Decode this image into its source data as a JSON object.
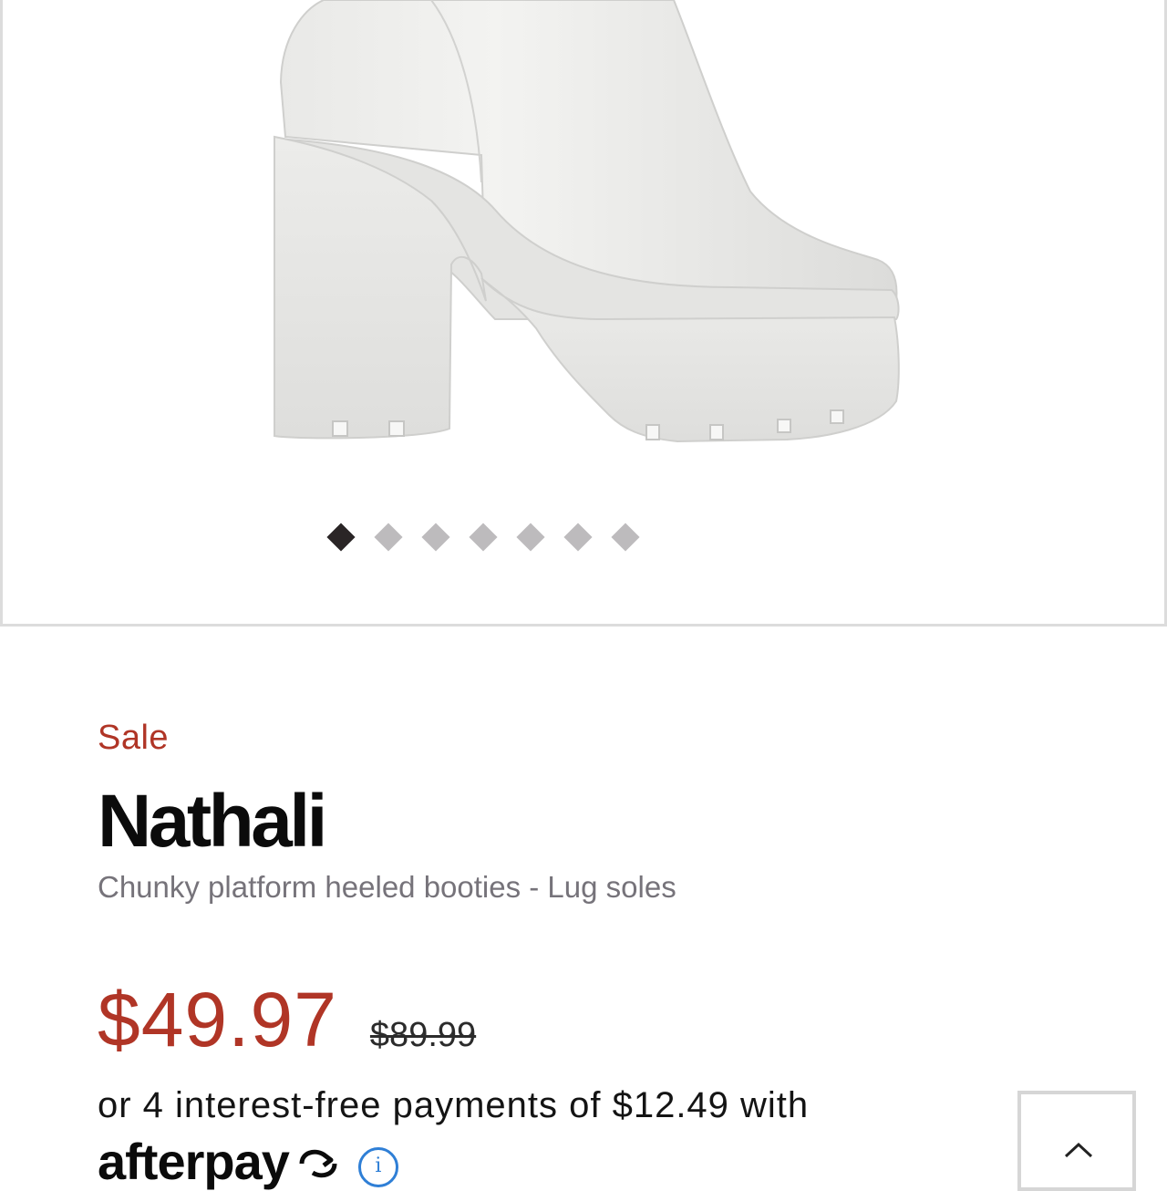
{
  "gallery": {
    "image_alt": "White chunky platform heeled bootie",
    "dot_count": 7,
    "active_dot": 1
  },
  "product": {
    "badge": "Sale",
    "name": "Nathali",
    "description": "Chunky platform heeled booties - Lug soles"
  },
  "pricing": {
    "sale_price": "$49.97",
    "original_price": "$89.99",
    "installments_text": "or 4 interest-free payments of $12.49 with",
    "provider_logo": "afterpay",
    "info_icon": "info-icon"
  },
  "back_to_top": {
    "icon": "chevron-up-icon"
  },
  "colors": {
    "sale_red": "#b03526",
    "description_gray": "#76737a",
    "dot_active": "#2a2526",
    "dot_inactive": "#bdbbbd",
    "info_blue": "#2f7fd6"
  }
}
